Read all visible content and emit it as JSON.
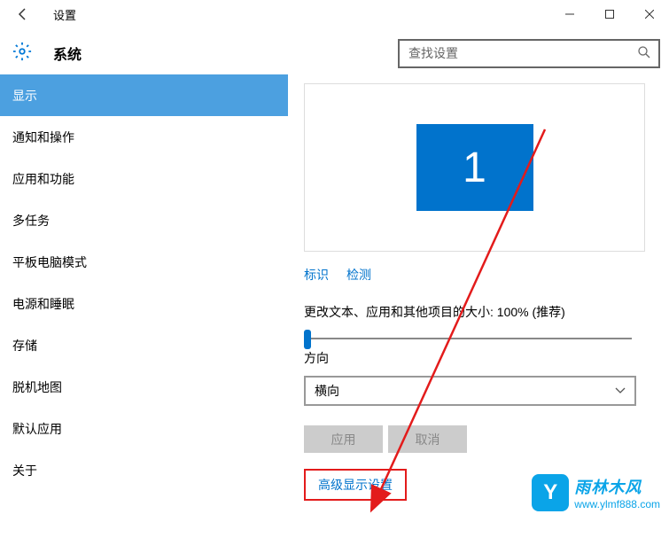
{
  "window": {
    "title": "设置"
  },
  "header": {
    "title": "系统",
    "search_placeholder": "查找设置"
  },
  "sidebar": {
    "items": [
      {
        "label": "显示",
        "selected": true
      },
      {
        "label": "通知和操作"
      },
      {
        "label": "应用和功能"
      },
      {
        "label": "多任务"
      },
      {
        "label": "平板电脑模式"
      },
      {
        "label": "电源和睡眠"
      },
      {
        "label": "存储"
      },
      {
        "label": "脱机地图"
      },
      {
        "label": "默认应用"
      },
      {
        "label": "关于"
      }
    ]
  },
  "display": {
    "monitor_number": "1",
    "identify_label": "标识",
    "detect_label": "检测",
    "scale_label": "更改文本、应用和其他项目的大小: 100% (推荐)",
    "orientation_label": "方向",
    "orientation_value": "横向",
    "apply_label": "应用",
    "cancel_label": "取消",
    "advanced_label": "高级显示设置"
  },
  "watermark": {
    "badge": "Y",
    "title": "雨林木风",
    "url": "www.ylmf888.com"
  }
}
